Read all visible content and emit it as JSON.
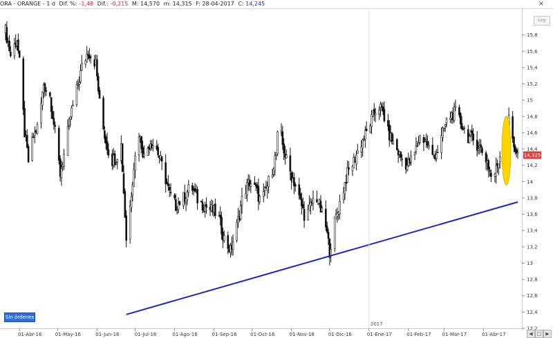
{
  "header": {
    "symbol": "ORA - ORANGE - 1 d",
    "dif_label": "Dif. %:",
    "dif_pct": "-1,48",
    "dif_abs_label": "Dif.:",
    "dif_abs": "-0,215",
    "max_label": "M: 14,570",
    "min_label": "m: 14,315",
    "date_label": "F: 28-04-2017",
    "close_label": "C: 14,245"
  },
  "controls": {
    "close": "×",
    "log": "Log"
  },
  "badge": "Sin órdenes",
  "year_marker": "2017",
  "current_price": "14,325",
  "colors": {
    "candles": "#111111",
    "trendline": "#1c23c4",
    "ellipse_fill": "#ffd500",
    "ellipse_stroke": "#e3b300",
    "price_tag": "#d84040",
    "badge": "#2f6fd6"
  },
  "chart_data": {
    "type": "candlestick",
    "symbol": "ORA - ORANGE",
    "x_range": [
      "2016-03-21",
      "2017-04-28"
    ],
    "ylim": [
      12.2,
      16.0
    ],
    "y_ticks": [
      12.2,
      12.4,
      12.6,
      12.8,
      13,
      13.2,
      13.4,
      13.6,
      13.8,
      14,
      14.2,
      14.4,
      14.6,
      14.8,
      15,
      15.2,
      15.4,
      15.6,
      15.8
    ],
    "y_tick_labels": [
      "12,2",
      "12,4",
      "12,6",
      "12,8",
      "13",
      "13,2",
      "13,4",
      "13,6",
      "13,8",
      "14",
      "14,2",
      "14,4",
      "14,6",
      "14,8",
      "15",
      "15,2",
      "15,4",
      "15,6",
      "15,8"
    ],
    "x_ticks": [
      {
        "date": "2016-04-01",
        "label": "01-Abr-16"
      },
      {
        "date": "2016-05-01",
        "label": "01-May-16"
      },
      {
        "date": "2016-06-01",
        "label": "01-Jun-16"
      },
      {
        "date": "2016-07-01",
        "label": "01-Jul-16"
      },
      {
        "date": "2016-08-01",
        "label": "01-Ago-16"
      },
      {
        "date": "2016-09-01",
        "label": "01-Sep-16"
      },
      {
        "date": "2016-10-01",
        "label": "01-Oct-16"
      },
      {
        "date": "2016-11-01",
        "label": "01-Nov-16"
      },
      {
        "date": "2016-12-01",
        "label": "01-Dic-16"
      },
      {
        "date": "2017-01-01",
        "label": "01-Ene-17"
      },
      {
        "date": "2017-02-01",
        "label": "01-Feb-17"
      },
      {
        "date": "2017-03-01",
        "label": "01-Mar-17"
      },
      {
        "date": "2017-04-01",
        "label": "01-Abr-17"
      }
    ],
    "year_marker": {
      "date": "2017-01-01",
      "label": "2017"
    },
    "current_price": 14.325,
    "series": [
      {
        "type": "close_path",
        "points": [
          [
            "2016-03-21",
            15.85
          ],
          [
            "2016-03-25",
            15.55
          ],
          [
            "2016-03-30",
            15.75
          ],
          [
            "2016-04-02",
            15.3
          ],
          [
            "2016-04-05",
            14.6
          ],
          [
            "2016-04-08",
            14.25
          ],
          [
            "2016-04-12",
            14.55
          ],
          [
            "2016-04-16",
            14.7
          ],
          [
            "2016-04-20",
            15.2
          ],
          [
            "2016-04-25",
            15.05
          ],
          [
            "2016-04-29",
            14.6
          ],
          [
            "2016-05-03",
            14.1
          ],
          [
            "2016-05-07",
            14.4
          ],
          [
            "2016-05-11",
            14.8
          ],
          [
            "2016-05-15",
            15.05
          ],
          [
            "2016-05-20",
            15.4
          ],
          [
            "2016-05-25",
            15.6
          ],
          [
            "2016-05-31",
            15.45
          ],
          [
            "2016-06-04",
            14.8
          ],
          [
            "2016-06-08",
            14.5
          ],
          [
            "2016-06-12",
            14.25
          ],
          [
            "2016-06-16",
            14.3
          ],
          [
            "2016-06-20",
            14.45
          ],
          [
            "2016-06-24",
            13.3
          ],
          [
            "2016-06-27",
            13.7
          ],
          [
            "2016-06-30",
            14.2
          ],
          [
            "2016-07-04",
            14.6
          ],
          [
            "2016-07-08",
            14.3
          ],
          [
            "2016-07-13",
            14.5
          ],
          [
            "2016-07-18",
            14.4
          ],
          [
            "2016-07-23",
            14.15
          ],
          [
            "2016-07-28",
            13.85
          ],
          [
            "2016-08-02",
            13.7
          ],
          [
            "2016-08-08",
            13.8
          ],
          [
            "2016-08-14",
            13.95
          ],
          [
            "2016-08-20",
            13.75
          ],
          [
            "2016-08-25",
            13.7
          ],
          [
            "2016-08-30",
            13.65
          ],
          [
            "2016-09-04",
            13.6
          ],
          [
            "2016-09-09",
            13.3
          ],
          [
            "2016-09-14",
            13.15
          ],
          [
            "2016-09-19",
            13.45
          ],
          [
            "2016-09-24",
            13.85
          ],
          [
            "2016-09-29",
            14.0
          ],
          [
            "2016-10-04",
            13.9
          ],
          [
            "2016-10-08",
            13.75
          ],
          [
            "2016-10-12",
            13.9
          ],
          [
            "2016-10-16",
            14.1
          ],
          [
            "2016-10-20",
            14.35
          ],
          [
            "2016-10-22",
            14.75
          ],
          [
            "2016-10-25",
            14.45
          ],
          [
            "2016-10-29",
            14.2
          ],
          [
            "2016-11-03",
            14.0
          ],
          [
            "2016-11-08",
            13.75
          ],
          [
            "2016-11-12",
            13.55
          ],
          [
            "2016-11-16",
            13.7
          ],
          [
            "2016-11-20",
            13.85
          ],
          [
            "2016-11-24",
            13.65
          ],
          [
            "2016-11-28",
            13.45
          ],
          [
            "2016-12-01",
            13.15
          ],
          [
            "2016-12-05",
            13.5
          ],
          [
            "2016-12-10",
            13.8
          ],
          [
            "2016-12-15",
            14.1
          ],
          [
            "2016-12-20",
            14.25
          ],
          [
            "2016-12-25",
            14.45
          ],
          [
            "2016-12-30",
            14.6
          ],
          [
            "2017-01-04",
            14.8
          ],
          [
            "2017-01-08",
            14.95
          ],
          [
            "2017-01-12",
            14.85
          ],
          [
            "2017-01-16",
            14.6
          ],
          [
            "2017-01-21",
            14.45
          ],
          [
            "2017-01-26",
            14.3
          ],
          [
            "2017-01-31",
            14.2
          ],
          [
            "2017-02-05",
            14.3
          ],
          [
            "2017-02-10",
            14.55
          ],
          [
            "2017-02-15",
            14.5
          ],
          [
            "2017-02-20",
            14.3
          ],
          [
            "2017-02-25",
            14.4
          ],
          [
            "2017-03-01",
            14.65
          ],
          [
            "2017-03-05",
            14.8
          ],
          [
            "2017-03-10",
            14.85
          ],
          [
            "2017-03-15",
            14.7
          ],
          [
            "2017-03-20",
            14.55
          ],
          [
            "2017-03-25",
            14.5
          ],
          [
            "2017-03-30",
            14.4
          ],
          [
            "2017-04-04",
            14.25
          ],
          [
            "2017-04-08",
            14.0
          ],
          [
            "2017-04-12",
            14.2
          ],
          [
            "2017-04-17",
            14.5
          ],
          [
            "2017-04-21",
            14.75
          ],
          [
            "2017-04-25",
            14.45
          ],
          [
            "2017-04-28",
            14.33
          ]
        ]
      },
      {
        "type": "trendline",
        "points": [
          [
            "2016-06-24",
            12.37
          ],
          [
            "2017-04-28",
            13.75
          ]
        ]
      }
    ],
    "annotations": [
      {
        "type": "ellipse",
        "center": [
          "2017-04-19",
          14.38
        ],
        "semi_axis_days": 3.5,
        "semi_axis_price": 0.42
      }
    ]
  }
}
